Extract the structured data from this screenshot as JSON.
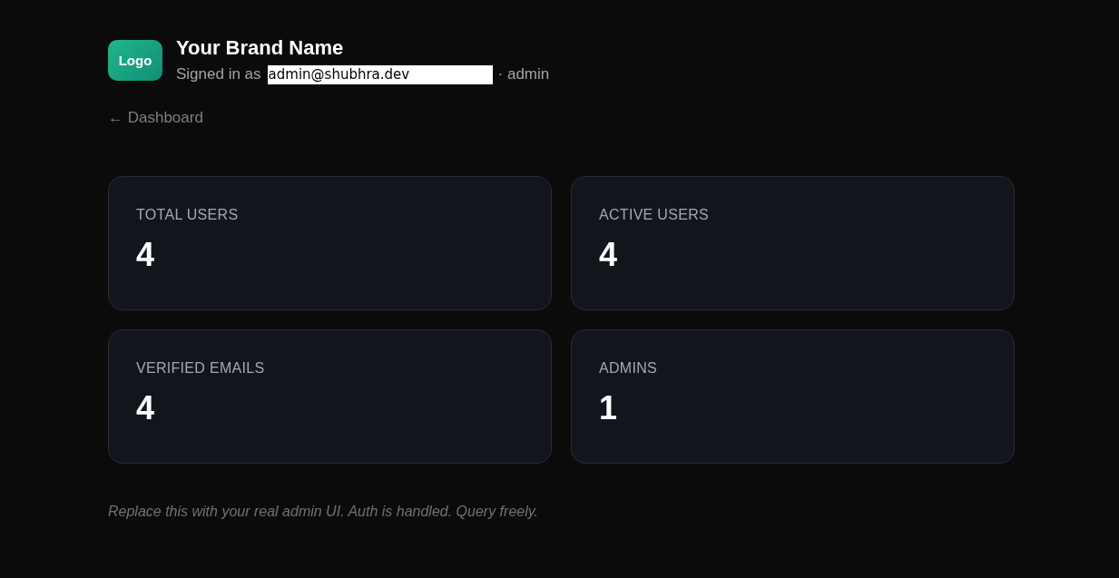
{
  "header": {
    "logo": "Logo",
    "brand": "Your Brand Name",
    "signed_in_prefix": "Signed in as",
    "email": "admin@shubhra.dev",
    "role": "· admin"
  },
  "back_link": "← Dashboard",
  "stats": [
    {
      "label": "TOTAL USERS",
      "value": "4"
    },
    {
      "label": "ACTIVE USERS",
      "value": "4"
    },
    {
      "label": "VERIFIED EMAILS",
      "value": "4"
    },
    {
      "label": "ADMINS",
      "value": "1"
    }
  ],
  "footnote": "Replace this with your real admin UI. Auth is handled. Query freely."
}
